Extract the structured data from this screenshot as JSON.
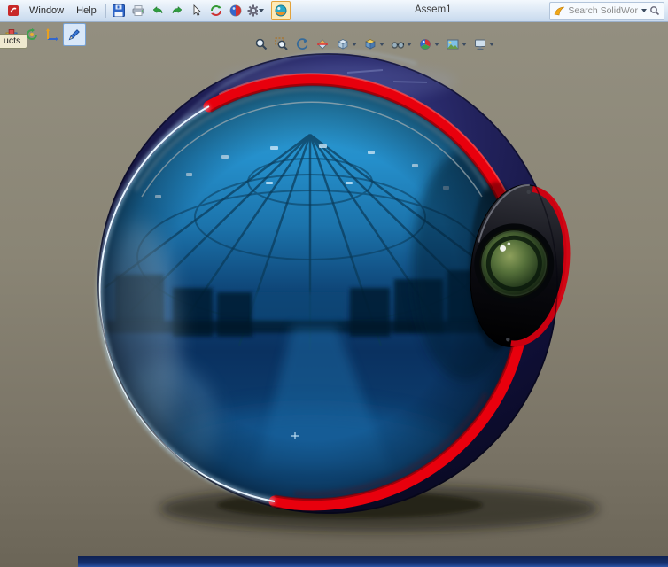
{
  "title_bar": {
    "menus": [
      "Window",
      "Help"
    ],
    "document_title": "Assem1",
    "search": {
      "text": "Search SolidWor",
      "icon": "solidworks-logo-icon"
    },
    "toolbar": [
      "save",
      "print",
      "undo",
      "redo",
      "select",
      "rebuild",
      "edit-color",
      "options",
      "photoview-preview"
    ],
    "toolbar_active_item": "photoview-preview"
  },
  "secondary_toolbar": {
    "items": [
      "insert-component",
      "motion-study",
      "instant3d",
      "edit-scene"
    ],
    "active_item": "edit-scene"
  },
  "left_tab": {
    "label": "ucts"
  },
  "headsup_toolbar": {
    "items": [
      "zoom-to-fit",
      "zoom-to-area",
      "previous-view",
      "section-view",
      "view-orientation",
      "display-style",
      "hide-show-items",
      "edit-appearance",
      "apply-scene",
      "view-settings"
    ],
    "with_dropdown": [
      "view-orientation",
      "display-style",
      "hide-show-items",
      "edit-appearance",
      "apply-scene",
      "view-settings"
    ]
  },
  "viewport": {
    "description": "Photorealistic render: spherical assembly with glossy dark-navy shell, red rim band, mirrored blue interior reflecting a domed warehouse, green lens module at right, soft shadow on tan ground",
    "cursor_marker": "+"
  },
  "colors": {
    "chrome_top": "#f3f8fd",
    "chrome_bottom": "#c8daee",
    "accent_red": "#e8000d",
    "shell_navy": "#101038",
    "reflection_blue": "#1f85c6",
    "lens_green": "#5f7d3e",
    "ground": "#8a8575",
    "bottom_bar_navy": "#16306e"
  }
}
